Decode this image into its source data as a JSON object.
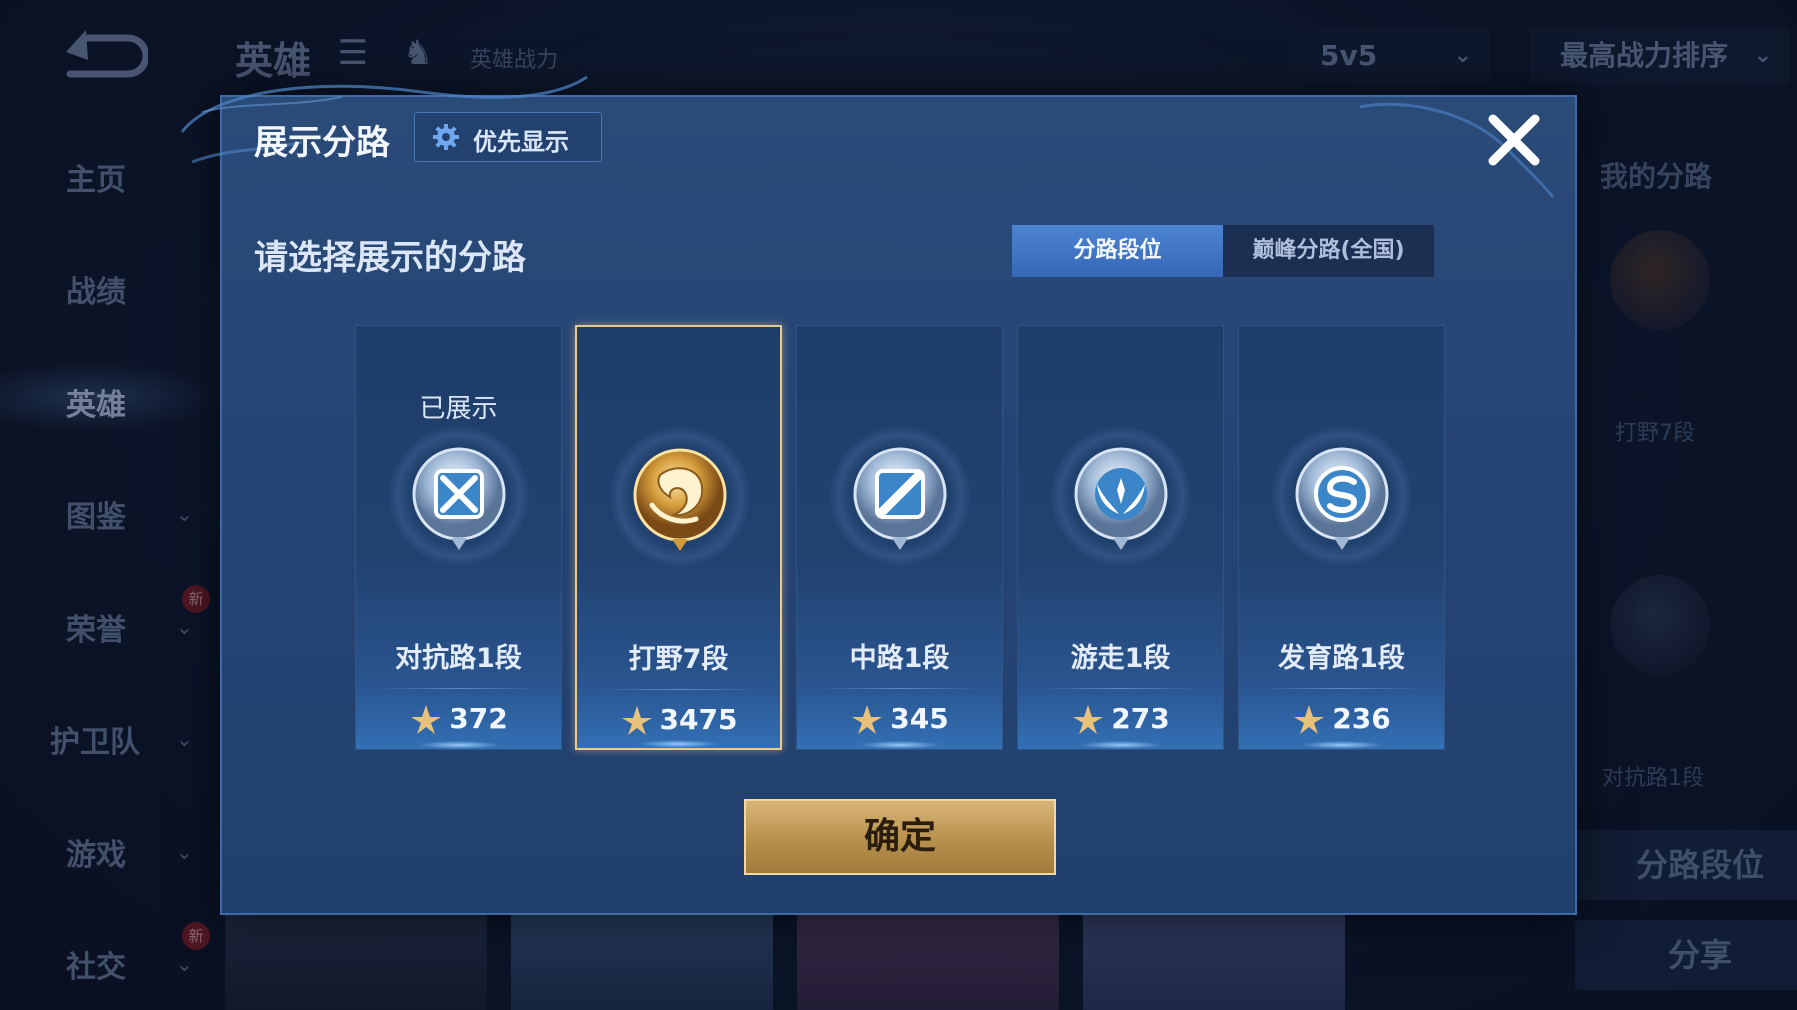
{
  "background": {
    "top_bar": {
      "title": "英雄",
      "list_icon": "list-icon",
      "hero_power_label": "英雄战力",
      "mode_dropdown": "5v5",
      "sort_dropdown": "最高战力排序"
    },
    "sidebar": {
      "items": [
        {
          "label": "主页",
          "has_chevron": false,
          "badge": ""
        },
        {
          "label": "战绩",
          "has_chevron": false,
          "badge": ""
        },
        {
          "label": "英雄",
          "has_chevron": false,
          "badge": "",
          "active": true
        },
        {
          "label": "图鉴",
          "has_chevron": true,
          "badge": ""
        },
        {
          "label": "荣誉",
          "has_chevron": true,
          "badge": "新"
        },
        {
          "label": "护卫队",
          "has_chevron": true,
          "badge": ""
        },
        {
          "label": "游戏",
          "has_chevron": true,
          "badge": ""
        },
        {
          "label": "社交",
          "has_chevron": true,
          "badge": "新"
        }
      ]
    },
    "right_panel": {
      "title": "我的分路",
      "entries": [
        "打野7段",
        "对抗路1段"
      ],
      "lane_rank_button": "分路段位",
      "share_button": "分享"
    }
  },
  "dialog": {
    "title": "展示分路",
    "priority_button": "优先显示",
    "prompt": "请选择展示的分路",
    "tabs": [
      {
        "label": "分路段位",
        "active": true
      },
      {
        "label": "巅峰分路(全国)",
        "active": false
      }
    ],
    "lanes": [
      {
        "name": "对抗路1段",
        "score": "372",
        "status": "已展示",
        "selected": false,
        "emblem": "clash-lane-icon",
        "tier": "silver"
      },
      {
        "name": "打野7段",
        "score": "3475",
        "status": "",
        "selected": true,
        "emblem": "jungle-dragon-icon",
        "tier": "gold"
      },
      {
        "name": "中路1段",
        "score": "345",
        "status": "",
        "selected": false,
        "emblem": "mid-lane-icon",
        "tier": "silver"
      },
      {
        "name": "游走1段",
        "score": "273",
        "status": "",
        "selected": false,
        "emblem": "roam-wings-icon",
        "tier": "silver"
      },
      {
        "name": "发育路1段",
        "score": "236",
        "status": "",
        "selected": false,
        "emblem": "farm-lane-icon",
        "tier": "silver"
      }
    ],
    "confirm_button": "确定"
  },
  "colors": {
    "dialog_bg": "#254474",
    "accent_blue": "#4d84d2",
    "gold": "#d8b577",
    "selected_border": "#e9c98e"
  }
}
